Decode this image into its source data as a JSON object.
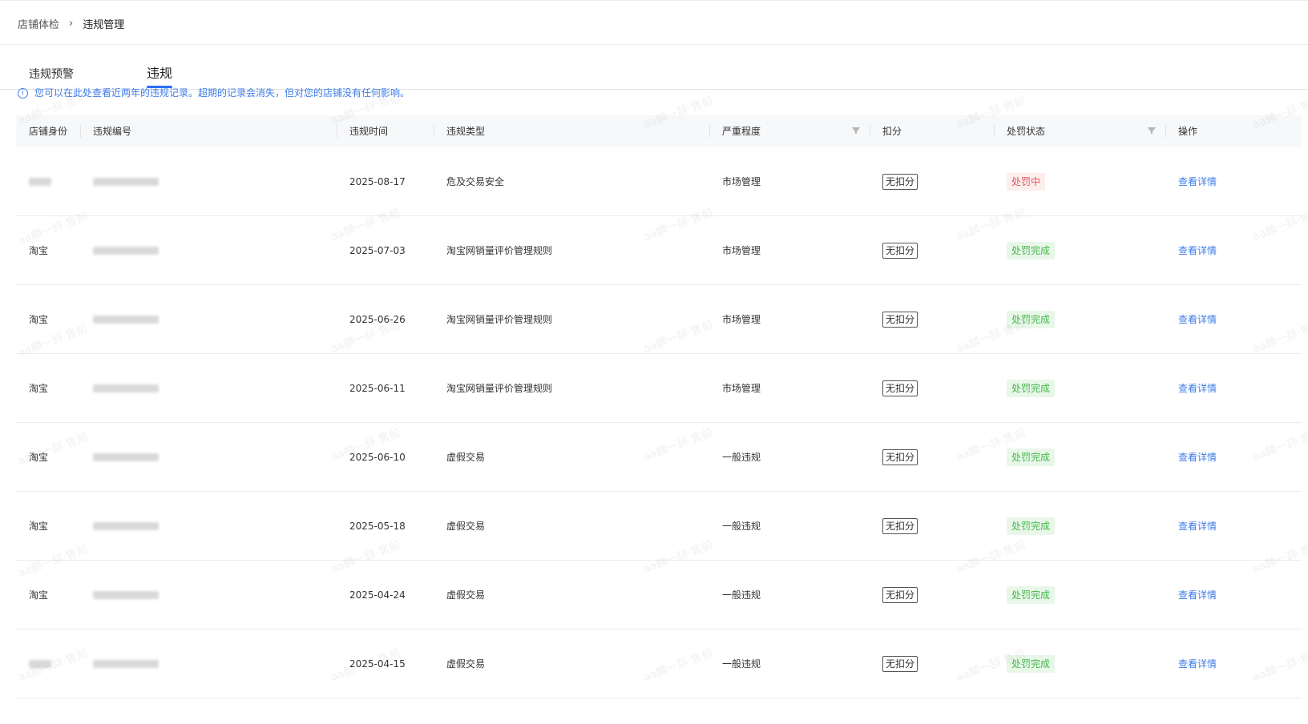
{
  "breadcrumb": {
    "parent": "店铺体检",
    "separator": "›",
    "current": "违规管理"
  },
  "tabs": [
    {
      "label": "违规预警"
    },
    {
      "label": "违规"
    }
  ],
  "notice": {
    "text": "您可以在此处查看近两年的违规记录。超期的记录会消失，但对您的店铺没有任何影响。"
  },
  "table": {
    "headers": {
      "shop_identity": "店铺身份",
      "violation_id": "违规编号",
      "violation_time": "违规时间",
      "violation_type": "违规类型",
      "severity": "严重程度",
      "deduction": "扣分",
      "status": "处罚状态",
      "action": "操作"
    },
    "rows": [
      {
        "shop": "",
        "time": "2025-08-17",
        "type": "危及交易安全",
        "severity": "市场管理",
        "deduction": "无扣分",
        "status": "处罚中",
        "status_kind": "punishing",
        "action": "查看详情"
      },
      {
        "shop": "淘宝",
        "time": "2025-07-03",
        "type": "淘宝网销量评价管理规则",
        "severity": "市场管理",
        "deduction": "无扣分",
        "status": "处罚完成",
        "status_kind": "done",
        "action": "查看详情"
      },
      {
        "shop": "淘宝",
        "time": "2025-06-26",
        "type": "淘宝网销量评价管理规则",
        "severity": "市场管理",
        "deduction": "无扣分",
        "status": "处罚完成",
        "status_kind": "done",
        "action": "查看详情"
      },
      {
        "shop": "淘宝",
        "time": "2025-06-11",
        "type": "淘宝网销量评价管理规则",
        "severity": "市场管理",
        "deduction": "无扣分",
        "status": "处罚完成",
        "status_kind": "done",
        "action": "查看详情"
      },
      {
        "shop": "淘宝",
        "time": "2025-06-10",
        "type": "虚假交易",
        "severity": "一般违规",
        "deduction": "无扣分",
        "status": "处罚完成",
        "status_kind": "done",
        "action": "查看详情"
      },
      {
        "shop": "淘宝",
        "time": "2025-05-18",
        "type": "虚假交易",
        "severity": "一般违规",
        "deduction": "无扣分",
        "status": "处罚完成",
        "status_kind": "done",
        "action": "查看详情"
      },
      {
        "shop": "淘宝",
        "time": "2025-04-24",
        "type": "虚假交易",
        "severity": "一般违规",
        "deduction": "无扣分",
        "status": "处罚完成",
        "status_kind": "done",
        "action": "查看详情"
      },
      {
        "shop": "",
        "time": "2025-04-15",
        "type": "虚假交易",
        "severity": "一般违规",
        "deduction": "无扣分",
        "status": "处罚完成",
        "status_kind": "done",
        "action": "查看详情"
      }
    ]
  },
  "watermark_text": "aa麟一辞·售前",
  "colors": {
    "accent": "#2b6fff",
    "link": "#3f7ce8",
    "punishing_bg": "#fdeeee",
    "punishing_fg": "#e0565b",
    "done_bg": "#e9f7e9",
    "done_fg": "#43b94a"
  },
  "icons": {
    "breadcrumb_separator": "chevron-right-icon",
    "notice": "info-circle-icon",
    "header_filter": "filter-icon"
  }
}
